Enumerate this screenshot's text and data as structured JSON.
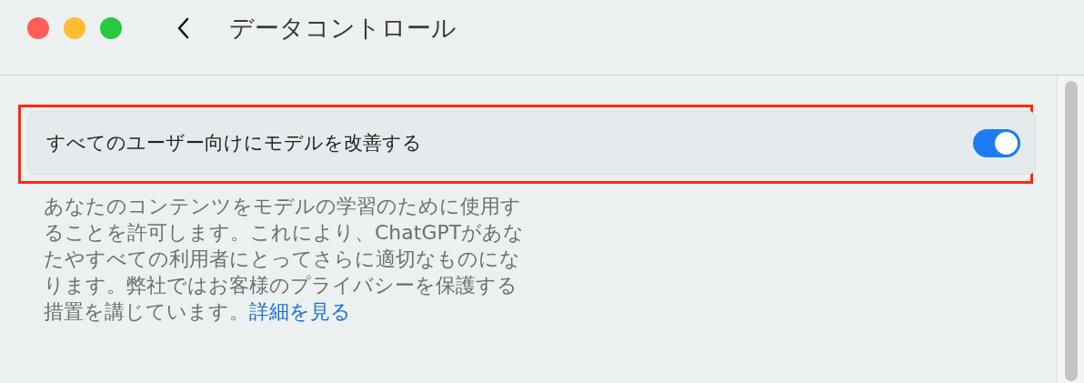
{
  "window": {
    "title": "データコントロール",
    "traffic_lights": [
      {
        "color": "#ff5f57"
      },
      {
        "color": "#febc2e"
      },
      {
        "color": "#28c840"
      }
    ]
  },
  "settings": [
    {
      "label": "すべてのユーザー向けにモデルを改善する",
      "on": true,
      "highlighted": true,
      "description": "あなたのコンテンツをモデルの学習のために使用することを許可します。これにより、ChatGPTがあなたやすべての利用者にとってさらに適切なものになります。弊社ではお客様のプライバシーを保護する措置を講じています。",
      "link": "詳細を見る"
    }
  ]
}
